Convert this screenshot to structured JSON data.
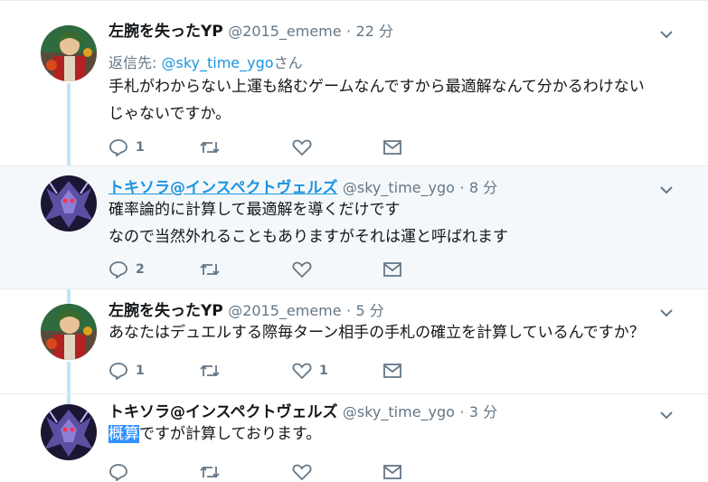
{
  "colors": {
    "accent": "#1b95e0",
    "thread_line": "#c4e4f8",
    "highlight_bg": "#f5f8fa",
    "muted": "#657786",
    "selection": "#3390ff"
  },
  "tweets": [
    {
      "name": "左腕を失ったYP",
      "handle": "@2015_ememe",
      "dot": "·",
      "time": "22 分",
      "reply_prefix": "返信先:",
      "reply_mention": "@sky_time_ygo",
      "reply_suffix": "さん",
      "lines": [
        "手札がわからない上運も絡むゲームなんですから最適解なんて分かるわけない",
        "じゃないですか。"
      ],
      "reply_count": "1",
      "like_count": "",
      "avatar_icon": "avatar-character-icon"
    },
    {
      "name": "トキソラ@インスペクトヴェルズ",
      "handle": "@sky_time_ygo",
      "dot": "·",
      "time": "8 分",
      "lines": [
        "確率論的に計算して最適解を導くだけです",
        "なので当然外れることもありますがそれは運と呼ばれます"
      ],
      "reply_count": "2",
      "like_count": "",
      "avatar_icon": "avatar-monster-icon"
    },
    {
      "name": "左腕を失ったYP",
      "handle": "@2015_ememe",
      "dot": "·",
      "time": "5 分",
      "lines": [
        "あなたはデュエルする際毎ターン相手の手札の確立を計算しているんですか？"
      ],
      "reply_count": "1",
      "like_count": "1",
      "avatar_icon": "avatar-character-icon"
    },
    {
      "name": "トキソラ@インスペクトヴェルズ",
      "handle": "@sky_time_ygo",
      "dot": "·",
      "time": "3 分",
      "selected_text": "概算",
      "rest_text": "ですが計算しております。",
      "reply_count": "",
      "like_count": "",
      "avatar_icon": "avatar-monster-icon"
    }
  ]
}
